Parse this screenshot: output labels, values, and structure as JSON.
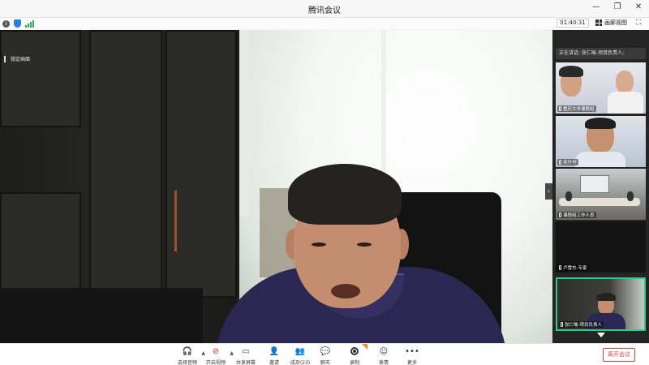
{
  "window": {
    "title": "腾讯会议"
  },
  "infobar": {
    "timer": "01:40:31",
    "view_label": "画廊视图"
  },
  "main": {
    "pin_label": "锁定画面"
  },
  "panel": {
    "speaking_text": "正在讲话: 张仁喻-项目负责人;",
    "tiles": [
      {
        "name": "重庆大学课题组"
      },
      {
        "name": "吴丹华"
      },
      {
        "name": "课题组工作人员"
      },
      {
        "name": "卢雪杰-专家"
      },
      {
        "name": "张仁喻-项目负责人"
      }
    ]
  },
  "toolbar": {
    "audio_label": "选择音频",
    "video_label": "开启视频",
    "share_label": "共享屏幕",
    "invite_label": "邀请",
    "members_label": "成员(23)",
    "chat_label": "聊天",
    "record_label": "录制",
    "emoji_label": "表情",
    "more_label": "更多",
    "leave_label": "离开会议"
  },
  "colors": {
    "accent_green": "#36c88a",
    "leave_red": "#e04343",
    "panel_bg": "#242424"
  }
}
